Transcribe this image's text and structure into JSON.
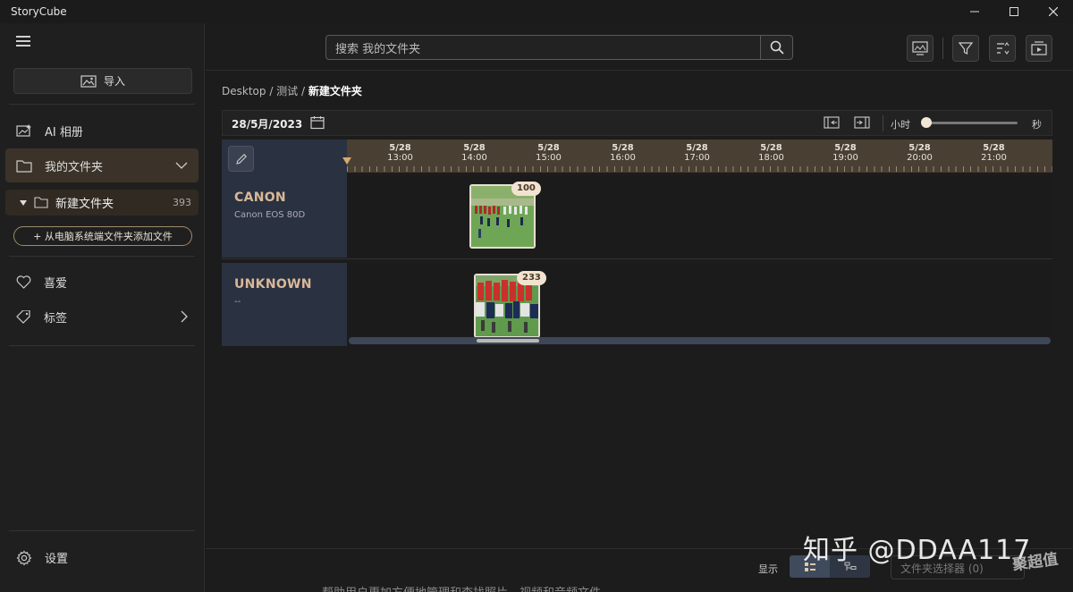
{
  "window": {
    "title": "StoryCube"
  },
  "sidebar": {
    "import_label": "导入",
    "items": [
      {
        "label": "AI 相册"
      },
      {
        "label": "我的文件夹"
      },
      {
        "label": "喜爱"
      },
      {
        "label": "标签"
      }
    ],
    "subfolder": {
      "label": "新建文件夹",
      "count": "393"
    },
    "add_files_label": "+ 从电脑系统端文件夹添加文件",
    "settings_label": "设置"
  },
  "search": {
    "placeholder": "搜索 我的文件夹"
  },
  "breadcrumb": {
    "part1": "Desktop",
    "sep": " / ",
    "part2": "测试",
    "current": "新建文件夹"
  },
  "datebar": {
    "date": "28/5月/2023",
    "hour_label": "小时",
    "second_label": "秒",
    "zoom_level": 0.0
  },
  "timeline": {
    "ticks": [
      {
        "date": "5/28",
        "time": "13:00"
      },
      {
        "date": "5/28",
        "time": "14:00"
      },
      {
        "date": "5/28",
        "time": "15:00"
      },
      {
        "date": "5/28",
        "time": "16:00"
      },
      {
        "date": "5/28",
        "time": "17:00"
      },
      {
        "date": "5/28",
        "time": "18:00"
      },
      {
        "date": "5/28",
        "time": "19:00"
      },
      {
        "date": "5/28",
        "time": "20:00"
      },
      {
        "date": "5/28",
        "time": "21:00"
      }
    ],
    "rows": [
      {
        "name": "CANON",
        "model": "Canon EOS 80D",
        "badge": "100"
      },
      {
        "name": "UNKNOWN",
        "model": "--",
        "badge": "233"
      }
    ]
  },
  "bottom": {
    "show_label": "显示",
    "file_chooser": "文件夹选择器 (0)"
  },
  "watermark": {
    "text": "知乎 @DDAA117",
    "logo": "聚超值"
  },
  "cut_text": "帮助用户更加方便地管理和查找照片、视频和音频文件",
  "colors": {
    "accent": "#d9b899",
    "active_bg": "#3b3329",
    "lane_bg": "#2a3140",
    "ruler_bg": "#4a3f33"
  }
}
